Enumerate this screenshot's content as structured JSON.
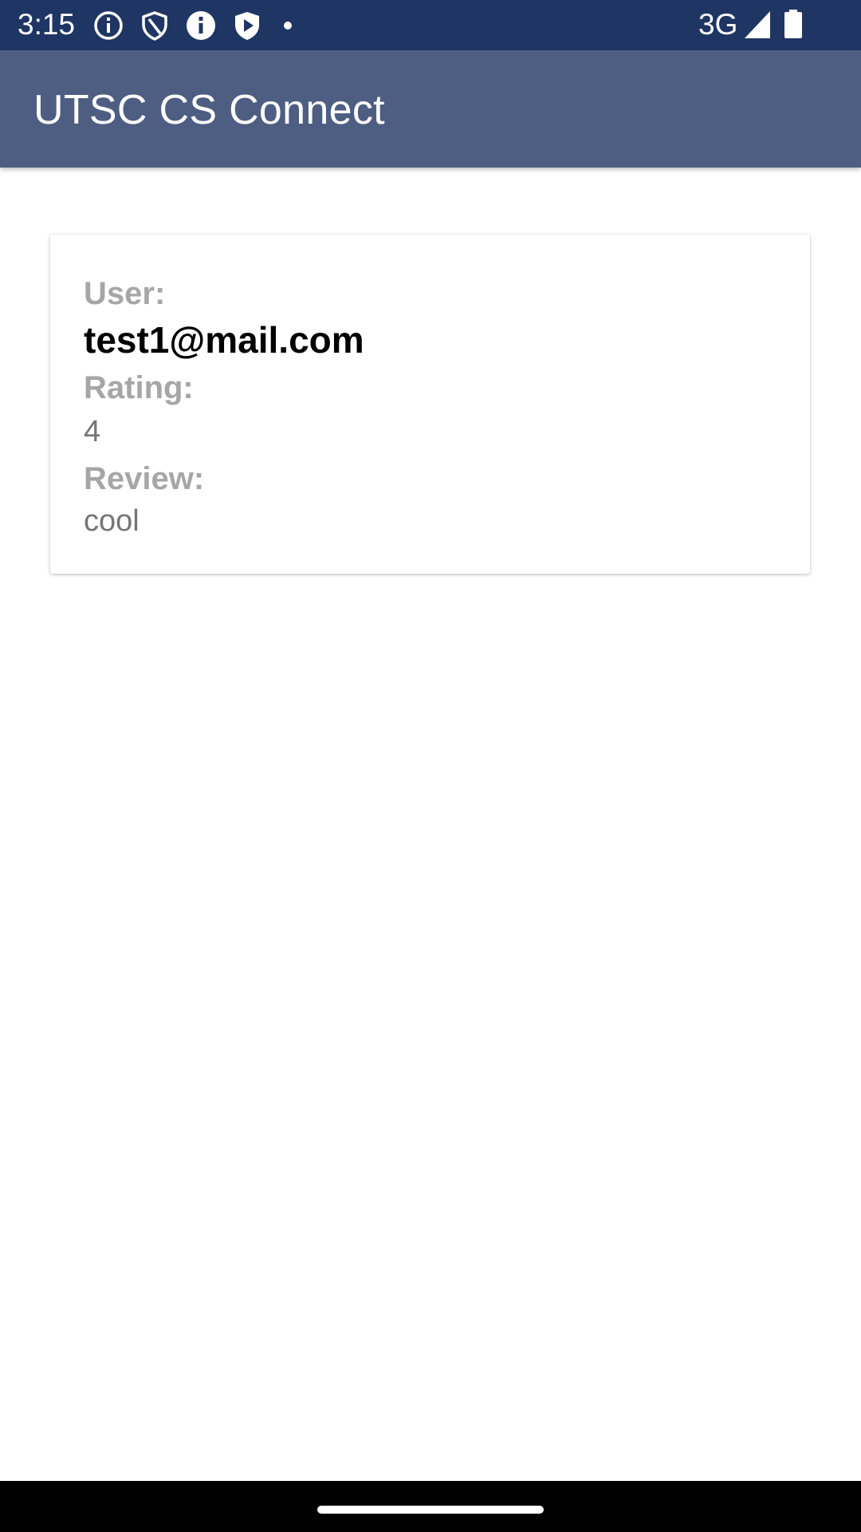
{
  "status_bar": {
    "time": "3:15",
    "network": "3G",
    "icons": [
      "info-outline-icon",
      "shield-outline-icon",
      "info-filled-icon",
      "play-shield-icon",
      "notification-dot-icon",
      "signal-icon",
      "battery-icon"
    ],
    "background_color": "#1f3563"
  },
  "app_bar": {
    "title": "UTSC CS Connect",
    "background_color": "#4e5e82"
  },
  "review": {
    "user_label": "User:",
    "user_value": "test1@mail.com",
    "rating_label": "Rating:",
    "rating_value": "4",
    "review_label": "Review:",
    "review_value": "cool"
  },
  "nav_bar": {
    "icons": [
      "home-indicator"
    ]
  }
}
